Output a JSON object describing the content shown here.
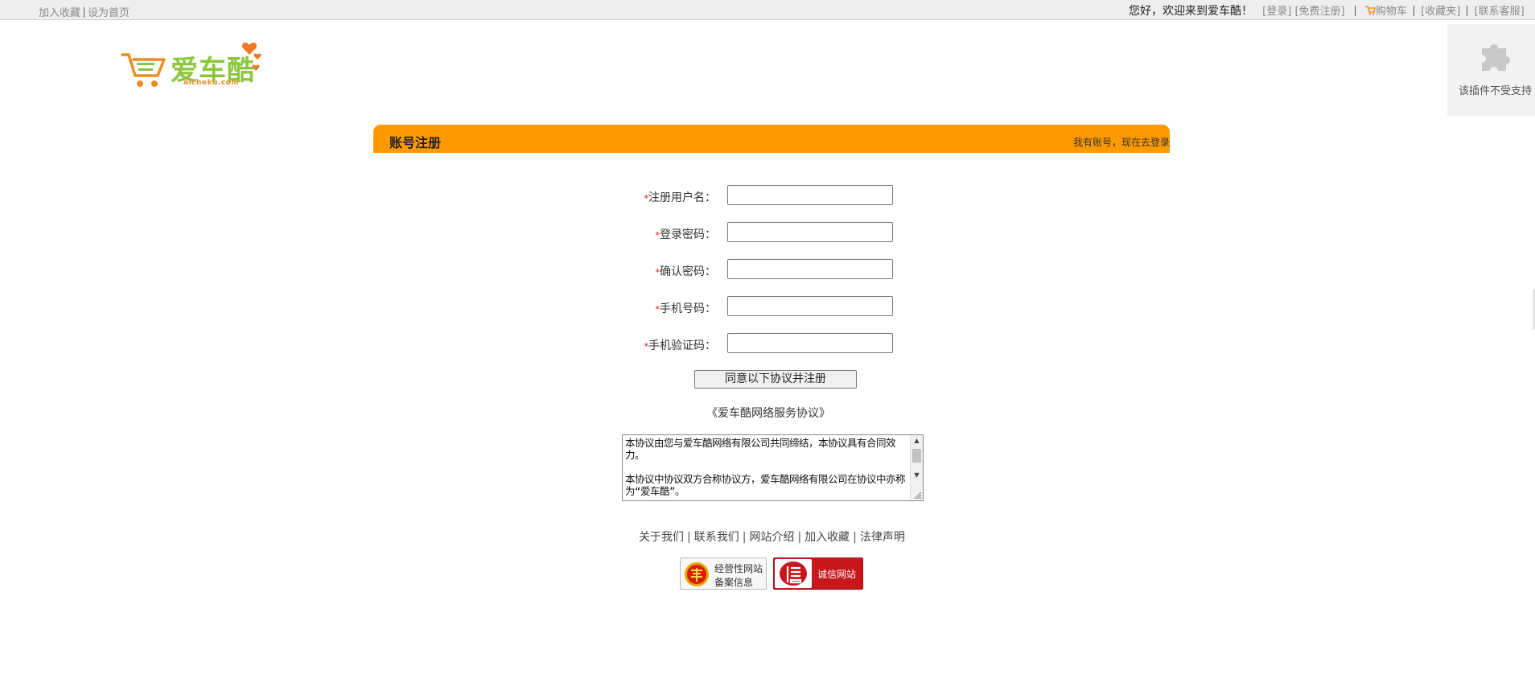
{
  "topbar": {
    "add_favorite": "加入收藏",
    "set_homepage": "设为首页",
    "welcome": "您好，欢迎来到爱车酷！",
    "login": "[登录]",
    "register": "[免费注册]",
    "cart": "购物车",
    "favorites": "[收藏夹]",
    "customer_service": "[联系客服]"
  },
  "logo": {
    "name": "爱车酷",
    "domain": "aicheku.com",
    "colors": {
      "green": "#8cc63f",
      "orange": "#f08c1e",
      "heart": "#f07820"
    }
  },
  "plugin": {
    "icon": "puzzle-icon",
    "text": "该插件不受支持"
  },
  "header": {
    "title": "账号注册",
    "login_link": "我有账号，现在去登录",
    "color": "#ff9900"
  },
  "form": {
    "required_mark": "*",
    "fields": [
      {
        "label": "注册用户名：",
        "value": "",
        "placeholder": ""
      },
      {
        "label": "登录密码：",
        "value": "",
        "placeholder": ""
      },
      {
        "label": "确认密码：",
        "value": "",
        "placeholder": ""
      },
      {
        "label": "手机号码：",
        "value": "",
        "placeholder": ""
      },
      {
        "label": "手机验证码：",
        "value": "",
        "placeholder": ""
      }
    ],
    "submit_label": "同意以下协议并注册"
  },
  "agreement": {
    "title": "《爱车酷网络服务协议》",
    "paragraphs": [
      "本协议由您与爱车酷网络有限公司共同缔结，本协议具有合同效力。",
      "本协议中协议双方合称协议方，爱车酷网络有限公司在协议中亦称为“爱车酷”。"
    ]
  },
  "footer": {
    "links": [
      "关于我们",
      "联系我们",
      "网站介绍",
      "加入收藏",
      "法律声明"
    ],
    "separator": "|",
    "badge_icp": {
      "line1": "经营性网站",
      "line2": "备案信息",
      "icon": "red-shield-icon"
    },
    "badge_trust": {
      "text": "诚信网站",
      "icon": "xin-seal-icon",
      "color": "#c8161d"
    }
  }
}
